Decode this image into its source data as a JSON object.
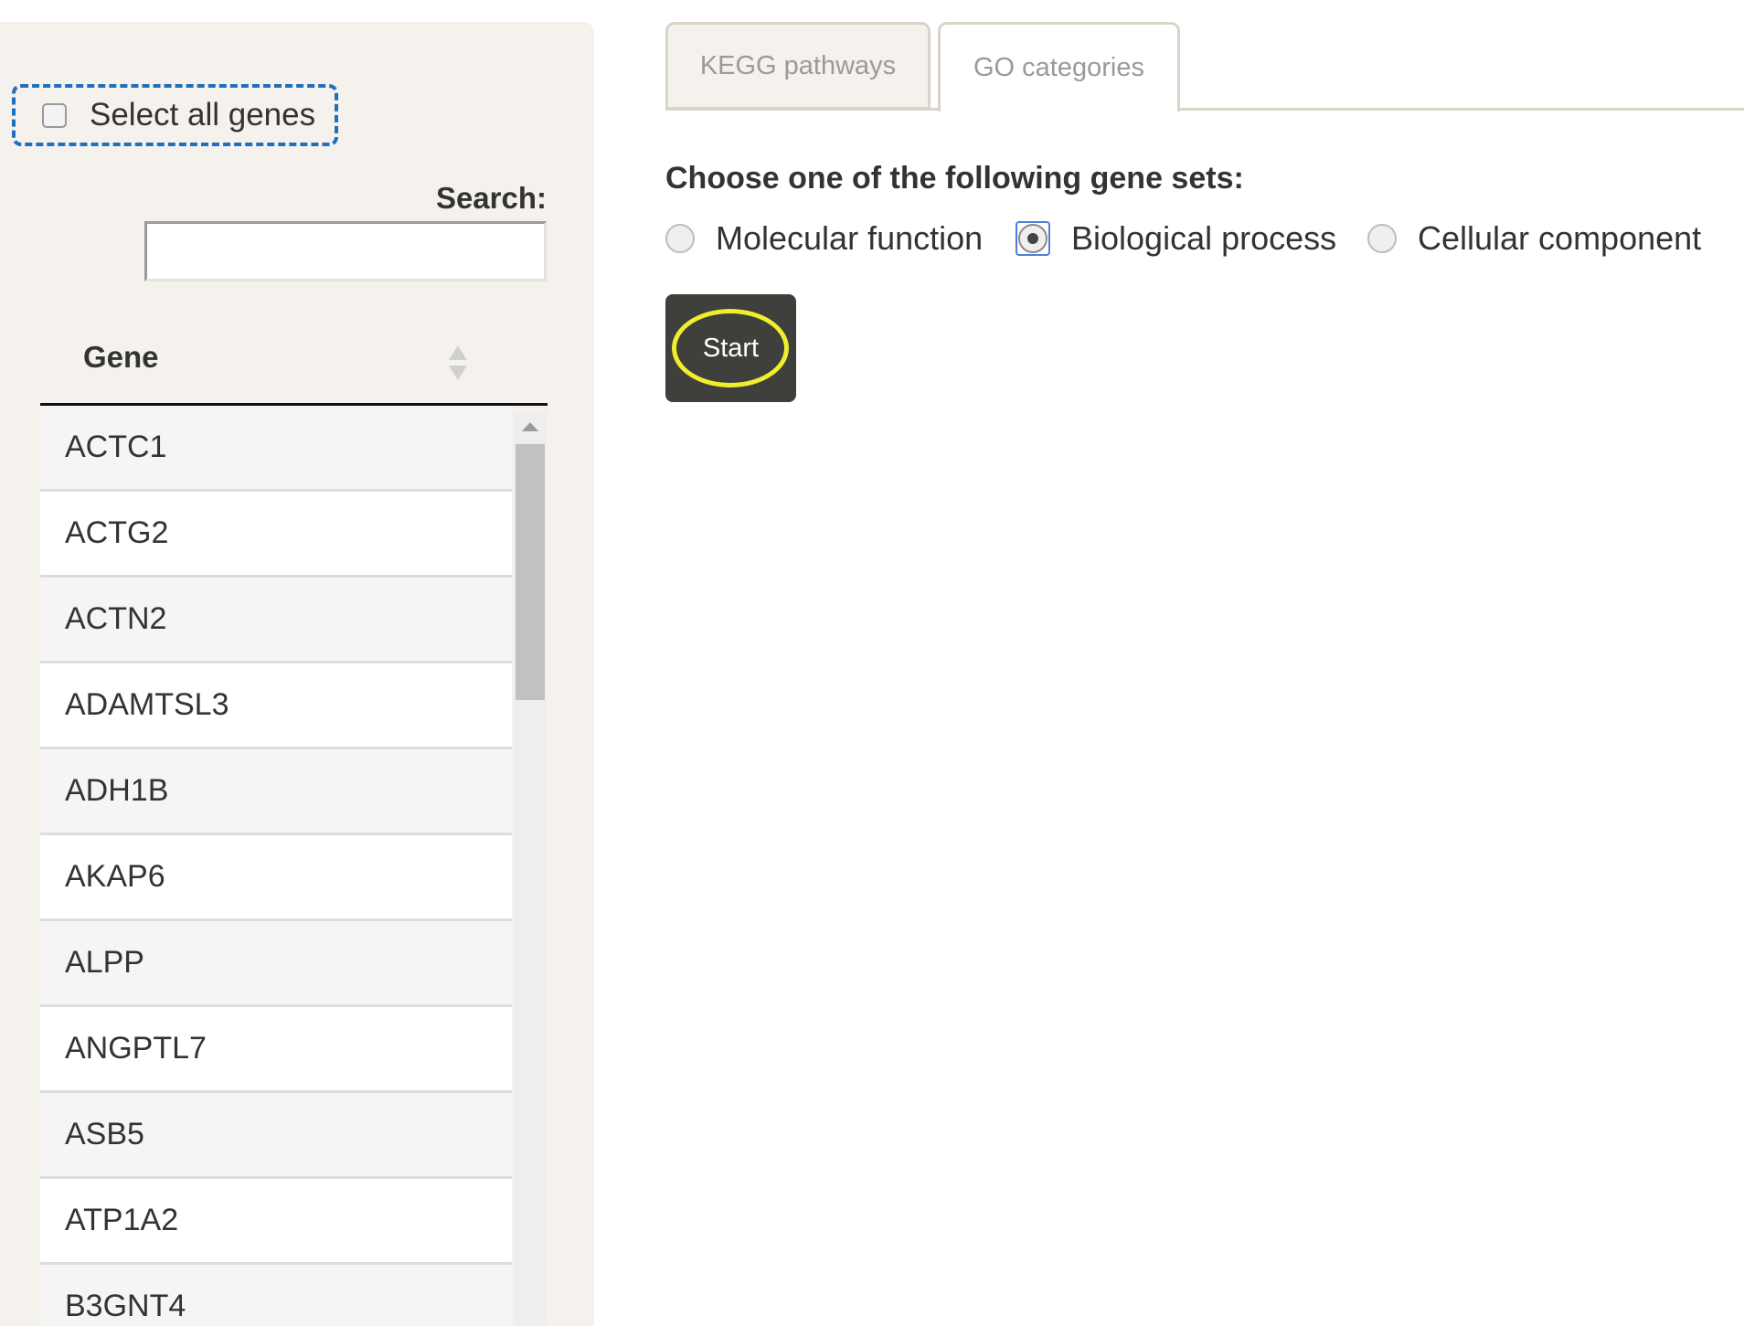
{
  "sidebar": {
    "select_all_label": "Select all genes",
    "search_label": "Search:",
    "search_value": "",
    "table": {
      "column_header": "Gene",
      "rows": [
        "ACTC1",
        "ACTG2",
        "ACTN2",
        "ADAMTSL3",
        "ADH1B",
        "AKAP6",
        "ALPP",
        "ANGPTL7",
        "ASB5",
        "ATP1A2",
        "B3GNT4"
      ]
    }
  },
  "tabs": [
    {
      "label": "KEGG pathways",
      "active": false
    },
    {
      "label": "GO categories",
      "active": true
    }
  ],
  "main": {
    "choose_label": "Choose one of the following gene sets:",
    "options": [
      {
        "label": "Molecular function",
        "selected": false
      },
      {
        "label": "Biological process",
        "selected": true
      },
      {
        "label": "Cellular component",
        "selected": false
      }
    ],
    "start_label": "Start"
  },
  "colors": {
    "sidebar_bg": "#f5f2ed",
    "highlight_dashed": "#1f6fbf",
    "start_button": "#3f3f3b",
    "start_highlight": "#f2ee2e"
  }
}
